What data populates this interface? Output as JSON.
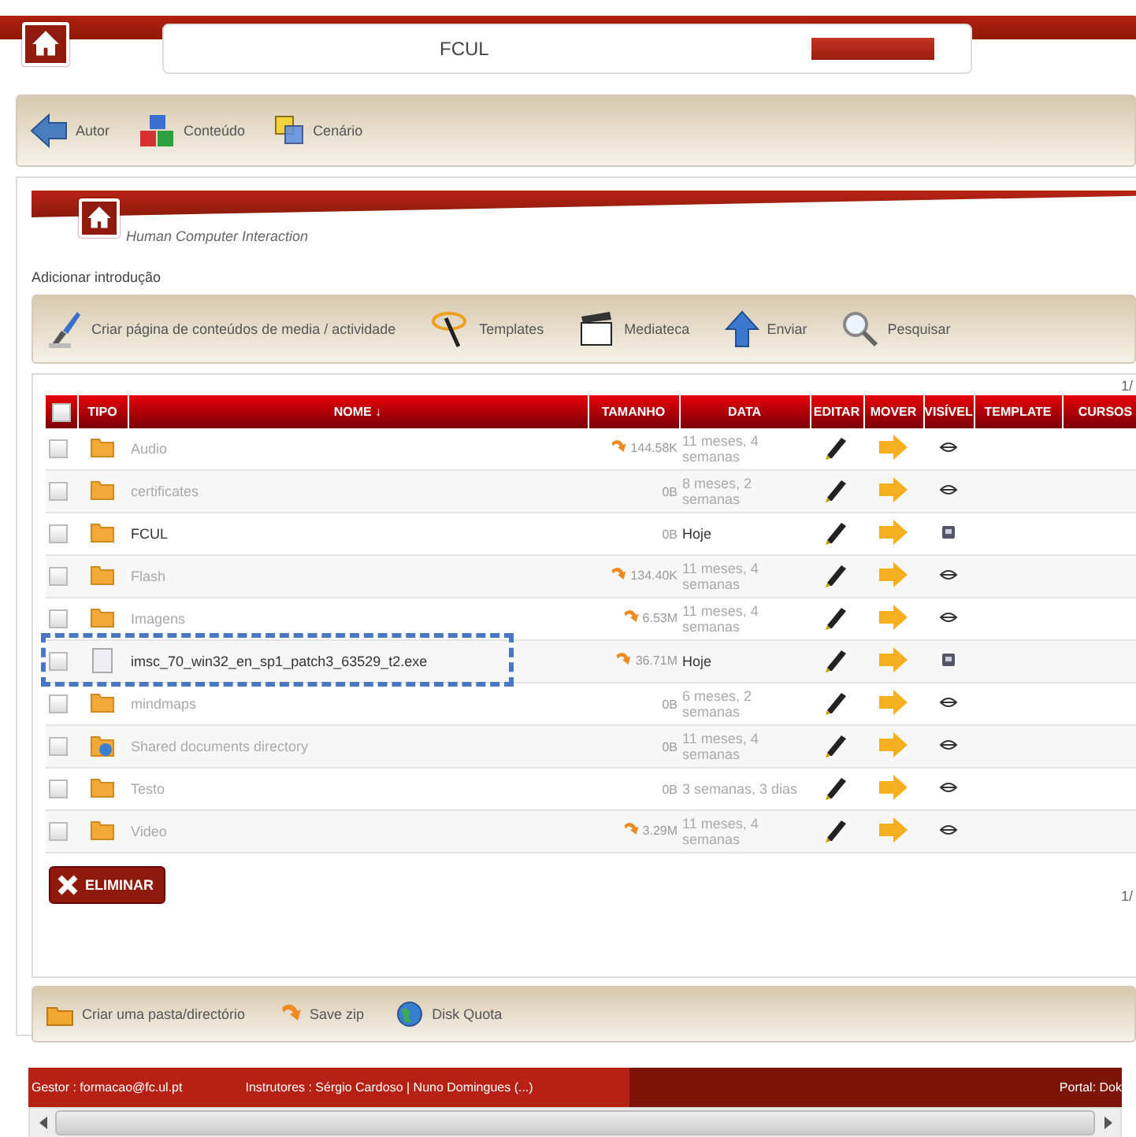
{
  "header": {
    "title": "FCUL"
  },
  "main_toolbar": [
    {
      "label": "Autor"
    },
    {
      "label": "Conteúdo"
    },
    {
      "label": "Cenário"
    }
  ],
  "course": {
    "title": "Human Computer Interaction",
    "intro_link": "Adicionar introdução"
  },
  "tools": [
    {
      "label": "Criar página de conteúdos de media / actividade"
    },
    {
      "label": "Templates"
    },
    {
      "label": "Mediateca"
    },
    {
      "label": "Enviar"
    },
    {
      "label": "Pesquisar"
    }
  ],
  "pager_top": "1/",
  "table": {
    "columns": [
      "TIPO",
      "NOME ↓",
      "TAMANHO",
      "DATA",
      "EDITAR",
      "MOVER",
      "VISÍVEL",
      "TEMPLATE",
      "CURSOS"
    ],
    "all_checked": false,
    "rows": [
      {
        "kind": "folder",
        "name": "Audio",
        "size": "144.58K",
        "zip": true,
        "date": "11 meses, 4 semanas",
        "visible": false,
        "checked": false
      },
      {
        "kind": "folder",
        "name": "certificates",
        "size": "0B",
        "zip": false,
        "date": "8 meses, 2 semanas",
        "visible": false,
        "checked": false
      },
      {
        "kind": "folder",
        "name": "FCUL",
        "size": "0B",
        "zip": false,
        "date": "Hoje",
        "visible": true,
        "checked": false
      },
      {
        "kind": "folder",
        "name": "Flash",
        "size": "134.40K",
        "zip": true,
        "date": "11 meses, 4 semanas",
        "visible": false,
        "checked": false
      },
      {
        "kind": "folder",
        "name": "Imagens",
        "size": "6.53M",
        "zip": true,
        "date": "11 meses, 4 semanas",
        "visible": false,
        "checked": false
      },
      {
        "kind": "file",
        "name": "imsc_70_win32_en_sp1_patch3_63529_t2.exe",
        "size": "36.71M",
        "zip": true,
        "date": "Hoje",
        "visible": true,
        "checked": false
      },
      {
        "kind": "folder",
        "name": "mindmaps",
        "size": "0B",
        "zip": false,
        "date": "6 meses, 2 semanas",
        "visible": false,
        "checked": false
      },
      {
        "kind": "shared",
        "name": "Shared documents directory",
        "size": "0B",
        "zip": false,
        "date": "11 meses, 4 semanas",
        "visible": false,
        "checked": false
      },
      {
        "kind": "folder",
        "name": "Testo",
        "size": "0B",
        "zip": false,
        "date": "3 semanas, 3 dias",
        "visible": false,
        "checked": false
      },
      {
        "kind": "folder",
        "name": "Video",
        "size": "3.29M",
        "zip": true,
        "date": "11 meses, 4 semanas",
        "visible": false,
        "checked": false
      }
    ]
  },
  "delete_button": "ELIMINAR",
  "pager_bottom": "1/",
  "bottom_toolbar": [
    {
      "label": "Criar uma pasta/directório"
    },
    {
      "label": "Save zip"
    },
    {
      "label": "Disk Quota"
    }
  ],
  "footer": {
    "manager": "Gestor : formacao@fc.ul.pt",
    "instructors": "Instrutores : Sérgio Cardoso | Nuno Domingues (...)",
    "portal": "Portal: Dok"
  }
}
